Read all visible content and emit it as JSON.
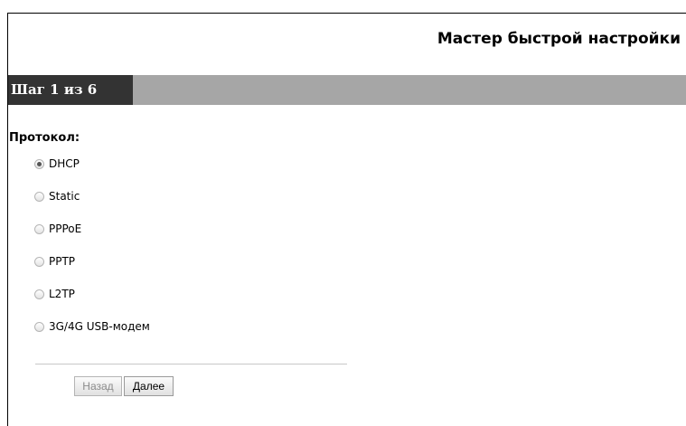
{
  "wizard": {
    "title": "Мастер быстрой настройки",
    "step_label": "Шаг 1 из 6"
  },
  "protocol": {
    "label": "Протокол:",
    "selected": "DHCP",
    "options": [
      {
        "label": "DHCP",
        "checked": true
      },
      {
        "label": "Static",
        "checked": false
      },
      {
        "label": "PPPoE",
        "checked": false
      },
      {
        "label": "PPTP",
        "checked": false
      },
      {
        "label": "L2TP",
        "checked": false
      },
      {
        "label": "3G/4G USB-модем",
        "checked": false
      }
    ]
  },
  "buttons": {
    "back_label": "Назад",
    "back_enabled": false,
    "next_label": "Далее"
  },
  "colors": {
    "step_bar": "#a6a6a6",
    "step_label_bg": "#333333"
  }
}
